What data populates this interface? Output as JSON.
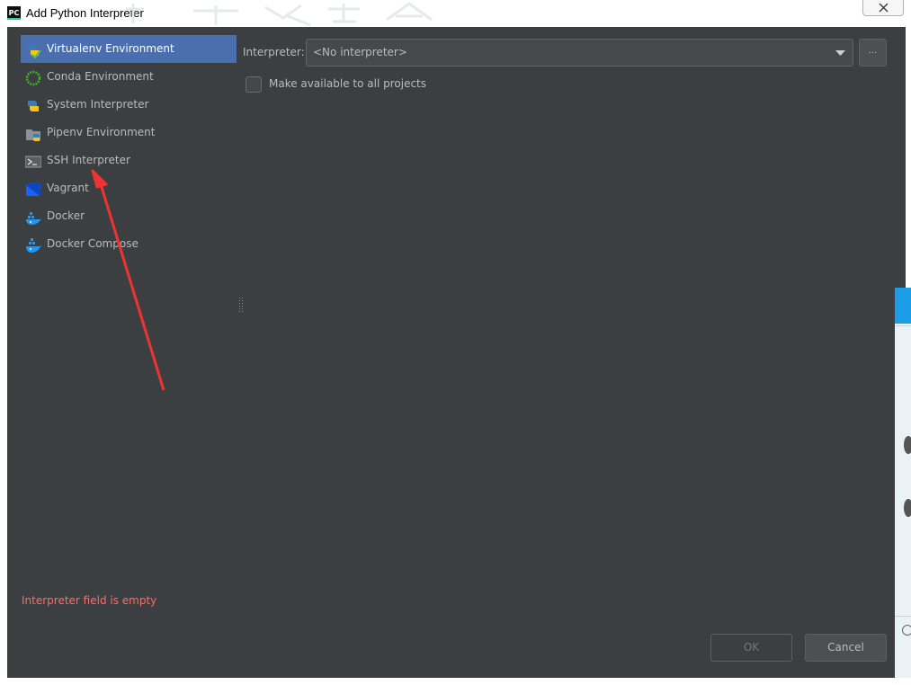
{
  "window": {
    "title": "Add Python Interpreter",
    "app_icon_text": "PC"
  },
  "sidebar": {
    "items": [
      {
        "label": "Virtualenv Environment",
        "icon": "virtualenv-icon",
        "selected": true
      },
      {
        "label": "Conda Environment",
        "icon": "conda-icon",
        "selected": false
      },
      {
        "label": "System Interpreter",
        "icon": "python-icon",
        "selected": false
      },
      {
        "label": "Pipenv Environment",
        "icon": "pipenv-icon",
        "selected": false
      },
      {
        "label": "SSH Interpreter",
        "icon": "terminal-icon",
        "selected": false
      },
      {
        "label": "Vagrant",
        "icon": "vagrant-icon",
        "selected": false
      },
      {
        "label": "Docker",
        "icon": "docker-icon",
        "selected": false
      },
      {
        "label": "Docker Compose",
        "icon": "docker-compose-icon",
        "selected": false
      }
    ]
  },
  "main": {
    "interpreter_label": "Interpreter:",
    "interpreter_value": "<No interpreter>",
    "browse_label": "...",
    "make_available_label": "Make available to all projects",
    "make_available_checked": false
  },
  "status": {
    "error_message": "Interpreter field is empty"
  },
  "buttons": {
    "ok_label": "OK",
    "cancel_label": "Cancel"
  },
  "colors": {
    "dialog_bg": "#3c3f41",
    "selection": "#4b6eaf",
    "error": "#ff6b68",
    "annotation_arrow": "#ee3333"
  }
}
